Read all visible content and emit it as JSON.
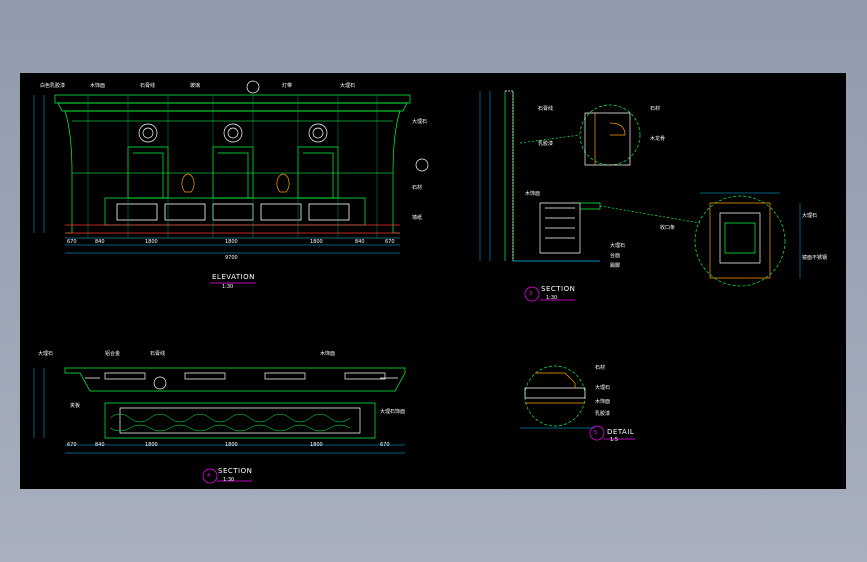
{
  "colors": {
    "background": "#000000",
    "line_main": "#00ff40",
    "line_dim": "#00c0ff",
    "text": "#ffffff",
    "accent": "#ff00ff",
    "wood": "#ffffff"
  },
  "elevation": {
    "title": "ELEVATION",
    "scale": "1:30",
    "labels_top": [
      "白色乳胶漆",
      "木饰面",
      "石膏线",
      "玻璃",
      "灯带",
      "大理石"
    ],
    "labels_right": [
      "大理石",
      "石材",
      "墙纸"
    ],
    "dims_bottom": [
      "670",
      "840",
      "1800",
      "1800",
      "1800",
      "840",
      "670"
    ],
    "dims_total": "9700"
  },
  "section_side": {
    "title": "SECTION",
    "number": "3",
    "scale": "1:30",
    "labels": [
      "石膏线",
      "乳胶漆",
      "木饰面",
      "大理石",
      "台面",
      "踢脚"
    ],
    "detail_labels": [
      "石材",
      "木龙骨",
      "收口条",
      "大理石",
      "镜面不锈钢"
    ]
  },
  "section_plan": {
    "title": "SECTION",
    "number": "4",
    "scale": "1:30",
    "labels": [
      "大理石",
      "铝合金",
      "石膏线",
      "木饰面",
      "夹板",
      "大理石饰面"
    ],
    "dims": [
      "670",
      "840",
      "1800",
      "1800",
      "1800",
      "670"
    ]
  },
  "detail": {
    "title": "DETAIL",
    "number": "5",
    "scale": "1:5",
    "labels": [
      "石材",
      "大理石",
      "木饰面",
      "乳胶漆"
    ]
  }
}
